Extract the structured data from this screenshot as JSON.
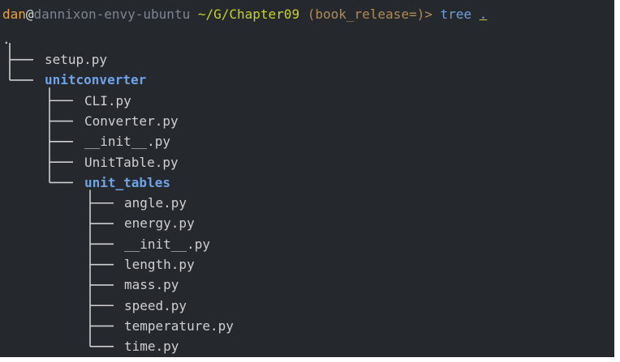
{
  "prompt": {
    "user": "dan",
    "at": "@",
    "host": "dannixon-envy-ubuntu",
    "path": "~/G/Chapter09",
    "git": "(book_release=)>",
    "command": "tree",
    "argument": "."
  },
  "tree": {
    "root": ".",
    "entries": [
      {
        "name": "setup.py",
        "type": "file",
        "depth": 1,
        "last": false
      },
      {
        "name": "unitconverter",
        "type": "dir",
        "depth": 1,
        "last": true
      },
      {
        "name": "CLI.py",
        "type": "file",
        "depth": 2,
        "last": false
      },
      {
        "name": "Converter.py",
        "type": "file",
        "depth": 2,
        "last": false
      },
      {
        "name": "__init__.py",
        "type": "file",
        "depth": 2,
        "last": false
      },
      {
        "name": "UnitTable.py",
        "type": "file",
        "depth": 2,
        "last": false
      },
      {
        "name": "unit_tables",
        "type": "dir",
        "depth": 2,
        "last": true
      },
      {
        "name": "angle.py",
        "type": "file",
        "depth": 3,
        "last": false
      },
      {
        "name": "energy.py",
        "type": "file",
        "depth": 3,
        "last": false
      },
      {
        "name": "__init__.py",
        "type": "file",
        "depth": 3,
        "last": false
      },
      {
        "name": "length.py",
        "type": "file",
        "depth": 3,
        "last": false
      },
      {
        "name": "mass.py",
        "type": "file",
        "depth": 3,
        "last": false
      },
      {
        "name": "speed.py",
        "type": "file",
        "depth": 3,
        "last": false
      },
      {
        "name": "temperature.py",
        "type": "file",
        "depth": 3,
        "last": false
      },
      {
        "name": "time.py",
        "type": "file",
        "depth": 3,
        "last": true
      }
    ]
  },
  "colors": {
    "background": "#25292e",
    "file": "#cfcfcf",
    "directory": "#6fa3e8",
    "tree_lines": "#cfcfcf"
  }
}
